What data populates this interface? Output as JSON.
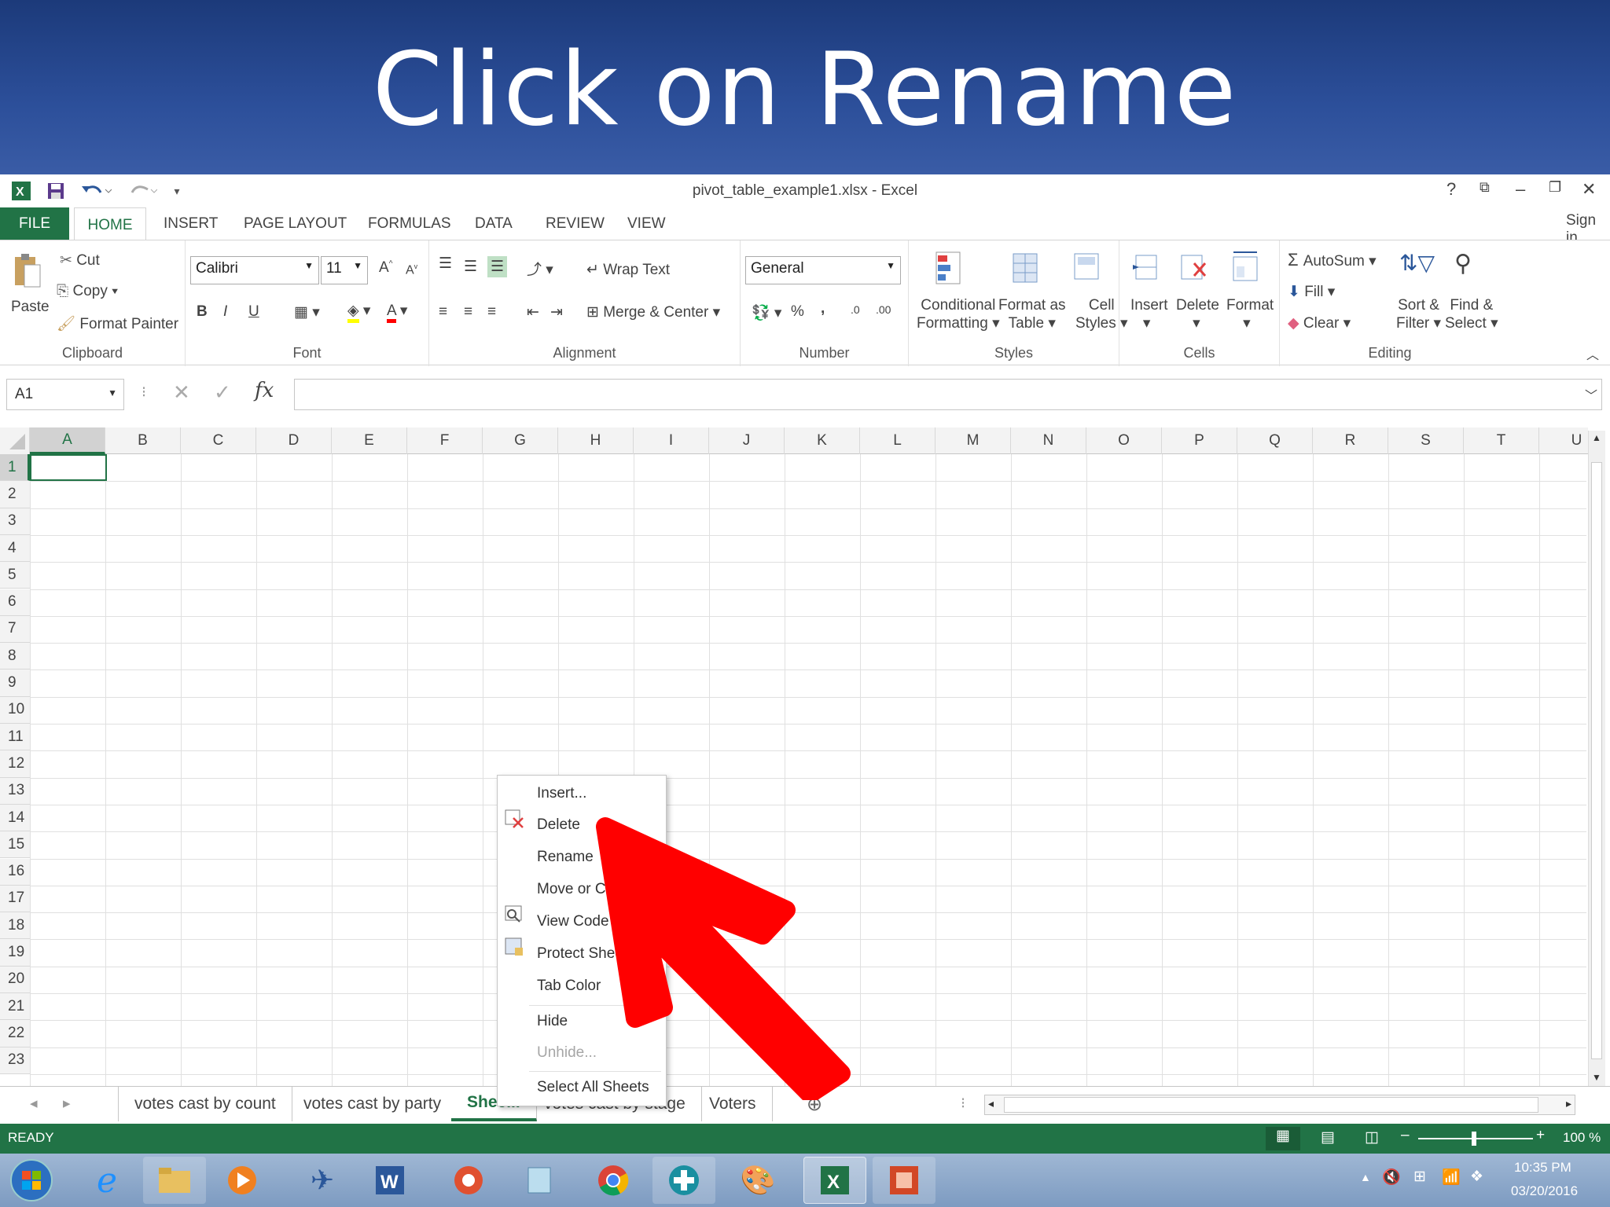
{
  "slide": {
    "title": "Click on Rename"
  },
  "window": {
    "title": "pivot_table_example1.xlsx - Excel",
    "help": "?",
    "sign_in": "Sign in"
  },
  "ribbon_tabs": [
    "FILE",
    "HOME",
    "INSERT",
    "PAGE LAYOUT",
    "FORMULAS",
    "DATA",
    "REVIEW",
    "VIEW"
  ],
  "clipboard": {
    "paste": "Paste",
    "cut": "Cut",
    "copy": "Copy",
    "format_painter": "Format Painter",
    "label": "Clipboard"
  },
  "font": {
    "name": "Calibri",
    "size": "11",
    "label": "Font",
    "bold": "B",
    "italic": "I",
    "underline": "U"
  },
  "alignment": {
    "wrap_text": "Wrap Text",
    "merge_center": "Merge & Center",
    "label": "Alignment"
  },
  "number": {
    "format": "General",
    "label": "Number",
    "percent": "%",
    "comma": ","
  },
  "styles": {
    "conditional": [
      "Conditional",
      "Formatting"
    ],
    "format_as": [
      "Format as",
      "Table"
    ],
    "cell_styles": [
      "Cell",
      "Styles"
    ],
    "label": "Styles"
  },
  "cells": {
    "insert": "Insert",
    "delete": "Delete",
    "format": "Format",
    "label": "Cells"
  },
  "editing": {
    "autosum": "AutoSum",
    "fill": "Fill",
    "clear": "Clear",
    "sort": [
      "Sort &",
      "Filter"
    ],
    "find": [
      "Find &",
      "Select"
    ],
    "label": "Editing"
  },
  "formula_bar": {
    "name_box": "A1",
    "fx": "fx",
    "value": ""
  },
  "columns": [
    "A",
    "B",
    "C",
    "D",
    "E",
    "F",
    "G",
    "H",
    "I",
    "J",
    "K",
    "L",
    "M",
    "N",
    "O",
    "P",
    "Q",
    "R",
    "S",
    "T",
    "U"
  ],
  "rows": [
    "1",
    "2",
    "3",
    "4",
    "5",
    "6",
    "7",
    "8",
    "9",
    "10",
    "11",
    "12",
    "13",
    "14",
    "15",
    "16",
    "17",
    "18",
    "19",
    "20",
    "21",
    "22",
    "23"
  ],
  "sheet_tabs": [
    "votes cast by count",
    "votes cast by party",
    "Shee...",
    "votes cast by stage",
    "Voters"
  ],
  "context_menu": [
    "Insert...",
    "Delete",
    "Rename",
    "Move or Copy...",
    "View Code",
    "Protect Sheet...",
    "Tab Color",
    "Hide",
    "Unhide...",
    "Select All Sheets"
  ],
  "status": {
    "ready": "READY",
    "zoom": "100 %"
  },
  "clock": {
    "time": "10:35 PM",
    "date": "03/20/2016"
  },
  "colors": {
    "excel_green": "#217346",
    "banner": "#2c4f9a",
    "arrow": "#ff0000"
  }
}
